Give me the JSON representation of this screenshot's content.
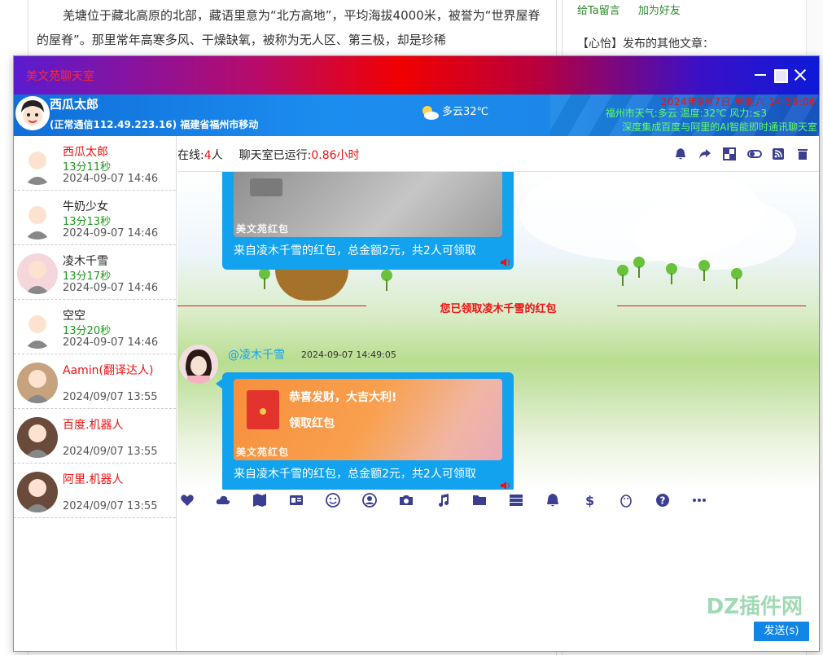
{
  "article": {
    "para1": "羌塘位于藏北高原的北部，藏语里意为“北方高地”，平均海拔4000米，被誉为“世界屋脊的屋脊”。那里常年高寒多风、干燥缺氧，被称为无人区、第三极，却是珍稀",
    "side_link_1": "给Ta留言",
    "side_link_2": "加为好友",
    "side_other": "【心怡】发布的其他文章："
  },
  "window": {
    "title": "美文苑聊天室"
  },
  "me": {
    "name": "西瓜太郎",
    "status": "(正常通信112.49.223.16)  福建省福州市移动",
    "weather": "多云32℃",
    "date": "2024年9月7日 星期六 14:59:06",
    "weather_line": "福州市天气:多云 温度:32℃ 风力:≤3",
    "promo": "深度集成百度与阿里的AI智能即时通讯聊天室"
  },
  "status": {
    "online_label": "在线:",
    "online_count": "4",
    "online_unit": "人",
    "runtime_label": "聊天室已运行:",
    "runtime_value": "0.86",
    "runtime_unit": "小时"
  },
  "members": [
    {
      "name": "西瓜太郎",
      "duration": "13分11秒",
      "time": "2024-09-07 14:46",
      "highlight": true
    },
    {
      "name": "牛奶少女",
      "duration": "13分13秒",
      "time": "2024-09-07 14:46",
      "highlight": false
    },
    {
      "name": "凌木千雪",
      "duration": "13分17秒",
      "time": "2024-09-07 14:46",
      "highlight": false
    },
    {
      "name": "空空",
      "duration": "13分20秒",
      "time": "2024-09-07 14:46",
      "highlight": false
    },
    {
      "name": "Aamin(翻译达人)",
      "duration": "",
      "time": "2024/09/07 13:55",
      "highlight": true
    },
    {
      "name": "百度.机器人",
      "duration": "",
      "time": "2024/09/07 13:55",
      "highlight": true
    },
    {
      "name": "阿里.机器人",
      "duration": "",
      "time": "2024/09/07 13:55",
      "highlight": true
    }
  ],
  "messages": {
    "first_brand": "美文苑红包",
    "first_caption": "来自凌木千雪的红包，总金额2元，共2人可领取",
    "notice": "您已领取凌木千雪的红包",
    "sender": "@凌木千雪",
    "sender_time": "2024-09-07 14:49:05",
    "packet_line1": "恭喜发财，大吉大利!",
    "packet_line2": "领取红包",
    "second_brand": "美文苑红包",
    "second_caption": "来自凌木千雪的红包，总金额2元，共2人可领取"
  },
  "compose": {
    "send_label": "发送(s)",
    "watermark": "DZ插件网"
  },
  "icons": {
    "status_toolbar": [
      "bell-icon",
      "share-icon",
      "theme-icon",
      "toggle-icon",
      "rss-icon",
      "trash-icon"
    ],
    "input_toolbar": [
      "heart-icon",
      "cloud-icon",
      "map-icon",
      "id-card-icon",
      "smile-icon",
      "user-circle-icon",
      "camera-icon",
      "music-icon",
      "folder-icon",
      "server-icon",
      "bell-icon",
      "dollar-icon",
      "penguin-icon",
      "help-icon",
      "more-icon"
    ]
  },
  "colors": {
    "accent_blue": "#12a2ee",
    "alert_red": "#e11111",
    "online_green": "#1a9a1a"
  }
}
